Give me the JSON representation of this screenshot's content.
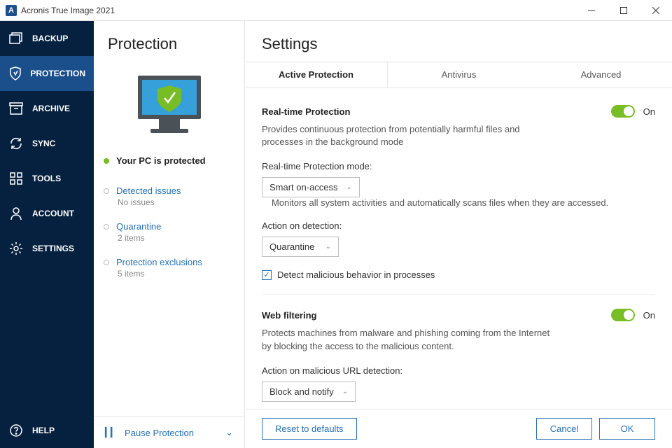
{
  "window": {
    "title": "Acronis True Image 2021"
  },
  "sidebar": {
    "items": [
      {
        "label": "BACKUP"
      },
      {
        "label": "PROTECTION"
      },
      {
        "label": "ARCHIVE"
      },
      {
        "label": "SYNC"
      },
      {
        "label": "TOOLS"
      },
      {
        "label": "ACCOUNT"
      },
      {
        "label": "SETTINGS"
      }
    ],
    "help": "HELP"
  },
  "panel": {
    "title": "Protection",
    "status": "Your PC is protected",
    "items": [
      {
        "label": "Detected issues",
        "sub": "No issues"
      },
      {
        "label": "Quarantine",
        "sub": "2 items"
      },
      {
        "label": "Protection exclusions",
        "sub": "5 items"
      }
    ],
    "pause": "Pause Protection"
  },
  "main": {
    "title": "Settings",
    "tabs": [
      {
        "label": "Active Protection"
      },
      {
        "label": "Antivirus"
      },
      {
        "label": "Advanced"
      }
    ],
    "sections": {
      "realtime": {
        "title": "Real-time Protection",
        "toggle_label": "On",
        "desc": "Provides continuous protection from potentially harmful files and processes in the background mode",
        "mode_label": "Real-time Protection mode:",
        "mode_value": "Smart on-access",
        "mode_hint": "Monitors all system activities and automatically scans files when they are accessed.",
        "action_label": "Action on detection:",
        "action_value": "Quarantine",
        "checkbox_label": "Detect malicious behavior in processes"
      },
      "web": {
        "title": "Web filtering",
        "toggle_label": "On",
        "desc": "Protects machines from malware and phishing coming from the Internet by blocking the access to the malicious content.",
        "action_label": "Action on malicious URL detection:",
        "action_value": "Block and notify"
      }
    },
    "footer": {
      "reset": "Reset to defaults",
      "cancel": "Cancel",
      "ok": "OK"
    }
  }
}
